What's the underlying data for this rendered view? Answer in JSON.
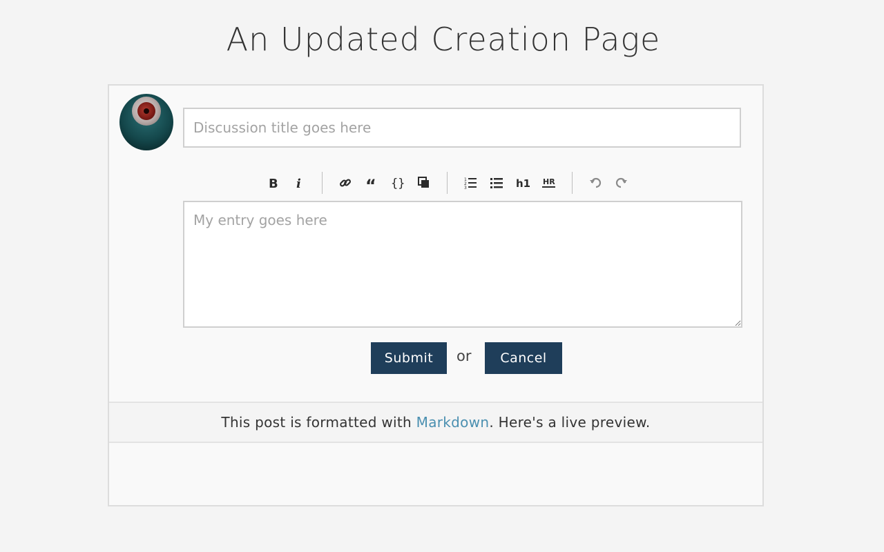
{
  "page": {
    "title": "An Updated Creation Page"
  },
  "form": {
    "title_placeholder": "Discussion title goes here",
    "body_placeholder": "My entry goes here",
    "submit_label": "Submit",
    "or_label": "or",
    "cancel_label": "Cancel"
  },
  "toolbar": {
    "groups": [
      [
        "bold-icon",
        "italic-icon"
      ],
      [
        "link-icon",
        "quote-icon",
        "code-icon",
        "image-icon"
      ],
      [
        "ordered-list-icon",
        "unordered-list-icon",
        "heading-icon",
        "horizontal-rule-icon"
      ],
      [
        "undo-icon",
        "redo-icon"
      ]
    ]
  },
  "footer_note": {
    "prefix": "This post is formatted with ",
    "link_text": "Markdown",
    "suffix": ". Here's a live preview."
  },
  "colors": {
    "button_bg": "#1f3e5a",
    "link": "#4a8fb0",
    "page_bg": "#f4f4f4"
  }
}
